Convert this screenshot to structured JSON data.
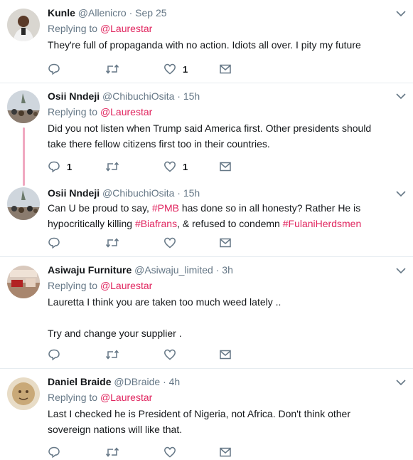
{
  "tweets": [
    {
      "name": "Kunle",
      "handle": "@Allenicro",
      "dot": "·",
      "time": "Sep 25",
      "replying_prefix": "Replying to ",
      "replying_to": "@Laurestar",
      "text_parts": [
        "They're full of propaganda with no action. Idiots all over. I pity my future"
      ],
      "reply_count": "",
      "retweet_count": "",
      "like_count": "1"
    },
    {
      "name": "Osii Nndeji",
      "handle": "@ChibuchiOsita",
      "dot": "·",
      "time": "15h",
      "replying_prefix": "Replying to ",
      "replying_to": "@Laurestar",
      "text_parts": [
        "Did you not listen when Trump said America first. Other presidents should take there fellow citizens first too in their countries."
      ],
      "reply_count": "1",
      "retweet_count": "",
      "like_count": "1"
    },
    {
      "name": "Osii Nndeji",
      "handle": "@ChibuchiOsita",
      "dot": "·",
      "time": "15h",
      "text_a": "Can U be proud to say, ",
      "hashtag_1": "#PMB",
      "text_b": " has done so in all honesty? Rather He is hypocritically killing ",
      "hashtag_2": "#Biafrans",
      "text_c": ", & refused to condemn ",
      "hashtag_3": "#FulaniHerdsmen",
      "reply_count": "",
      "retweet_count": "",
      "like_count": ""
    },
    {
      "name": "Asiwaju Furniture",
      "handle": "@Asiwaju_limited",
      "dot": "·",
      "time": "3h",
      "replying_prefix": "Replying to ",
      "replying_to": "@Laurestar",
      "text_line_1": "Lauretta I think you are taken too much weed lately ..",
      "text_line_2": "Try and change your supplier .",
      "reply_count": "",
      "retweet_count": "",
      "like_count": ""
    },
    {
      "name": "Daniel Braide",
      "handle": "@DBraide",
      "dot": "·",
      "time": "4h",
      "replying_prefix": "Replying to ",
      "replying_to": "@Laurestar",
      "text_parts": [
        "Last I checked he is President of Nigeria, not Africa. Don't think other sovereign nations will like that."
      ],
      "reply_count": "",
      "retweet_count": "",
      "like_count": ""
    }
  ],
  "colors": {
    "mention": "#e0245e",
    "muted": "#657786",
    "text": "#14171a",
    "divider": "#e6ecf0",
    "thread_line": "#f0a8c0"
  },
  "icons": [
    "reply-icon",
    "retweet-icon",
    "like-icon",
    "dm-icon",
    "chevron-down-icon"
  ]
}
